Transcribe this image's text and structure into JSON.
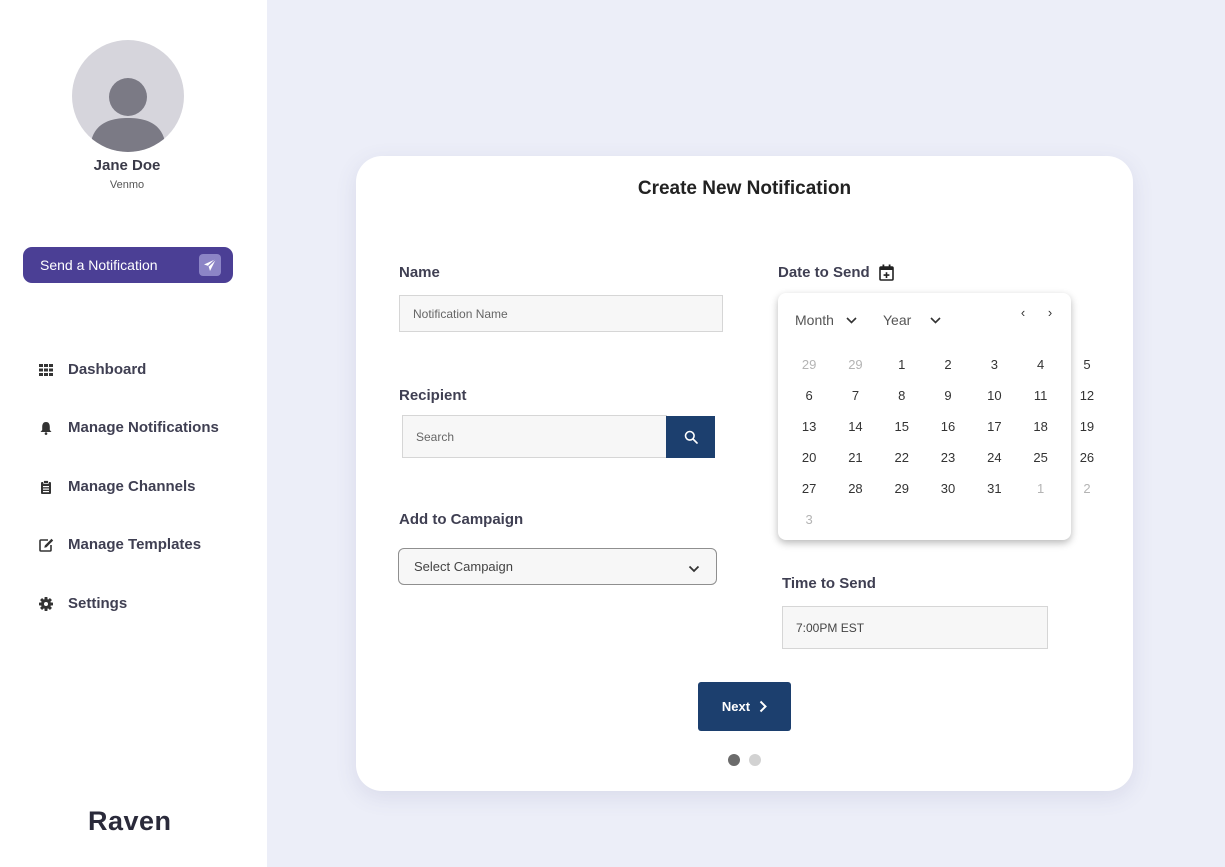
{
  "sidebar": {
    "user": {
      "name": "Jane Doe",
      "organization": "Venmo",
      "avatar_icon": "person-avatar-icon"
    },
    "send_button": {
      "label": "Send a Notification",
      "icon": "paper-plane-icon"
    },
    "nav": [
      {
        "label": "Dashboard",
        "icon": "grid-icon"
      },
      {
        "label": "Manage Notifications",
        "icon": "bell-icon"
      },
      {
        "label": "Manage Channels",
        "icon": "clipboard-icon"
      },
      {
        "label": "Manage Templates",
        "icon": "edit-icon"
      },
      {
        "label": "Settings",
        "icon": "gear-icon"
      }
    ],
    "brand": "Raven"
  },
  "form": {
    "title": "Create New Notification",
    "name": {
      "label": "Name",
      "placeholder": "Notification Name"
    },
    "recipient": {
      "label": "Recipient",
      "placeholder": "Search",
      "search_icon": "search-icon"
    },
    "campaign": {
      "label": "Add to Campaign",
      "selected": "Select Campaign"
    },
    "date": {
      "label": "Date to Send",
      "icon": "calendar-plus-icon",
      "month_label": "Month",
      "year_label": "Year",
      "prev_label": "‹",
      "next_label": "›",
      "days": [
        {
          "d": "29",
          "muted": true
        },
        {
          "d": "29",
          "muted": true
        },
        {
          "d": "1"
        },
        {
          "d": "2"
        },
        {
          "d": "3"
        },
        {
          "d": "4"
        },
        {
          "d": "5"
        },
        {
          "d": "6"
        },
        {
          "d": "7"
        },
        {
          "d": "8"
        },
        {
          "d": "9"
        },
        {
          "d": "10"
        },
        {
          "d": "11"
        },
        {
          "d": "12"
        },
        {
          "d": "13"
        },
        {
          "d": "14"
        },
        {
          "d": "15"
        },
        {
          "d": "16"
        },
        {
          "d": "17"
        },
        {
          "d": "18"
        },
        {
          "d": "19"
        },
        {
          "d": "20"
        },
        {
          "d": "21"
        },
        {
          "d": "22"
        },
        {
          "d": "23"
        },
        {
          "d": "24"
        },
        {
          "d": "25"
        },
        {
          "d": "26"
        },
        {
          "d": "27"
        },
        {
          "d": "28"
        },
        {
          "d": "29"
        },
        {
          "d": "30"
        },
        {
          "d": "31"
        },
        {
          "d": "1",
          "muted": true
        },
        {
          "d": "2",
          "muted": true
        },
        {
          "d": "3",
          "muted": true
        }
      ]
    },
    "time": {
      "label": "Time to Send",
      "value": "7:00PM EST"
    },
    "next_button": {
      "label": "Next"
    },
    "pagination": {
      "current": 1,
      "total": 2
    }
  },
  "colors": {
    "accent_purple": "#4b3f95",
    "primary_navy": "#1c3f6e",
    "background": "#eceef8"
  }
}
